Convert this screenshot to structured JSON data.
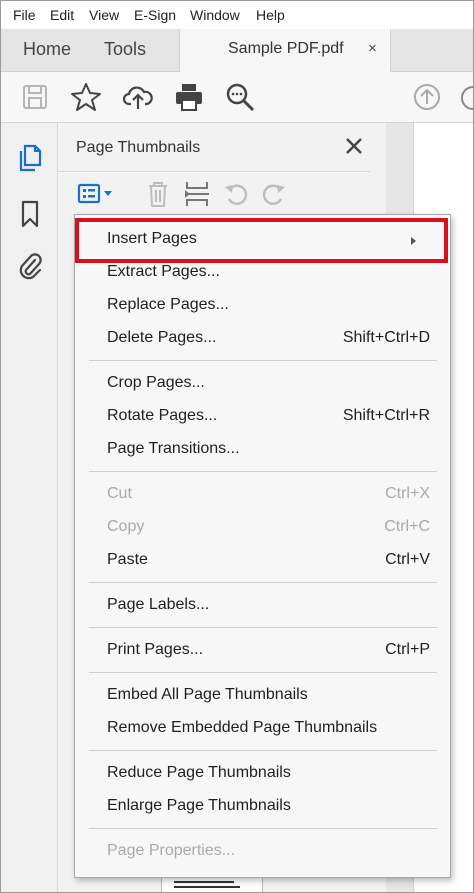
{
  "menubar": {
    "items": [
      "File",
      "Edit",
      "View",
      "E-Sign",
      "Window",
      "Help"
    ]
  },
  "tabs": {
    "home": "Home",
    "tools": "Tools",
    "document": "Sample PDF.pdf",
    "close": "×"
  },
  "toolbar": {
    "icons": [
      "save-icon",
      "star-icon",
      "cloud-upload-icon",
      "print-icon",
      "search-icon",
      "arrow-up-icon"
    ]
  },
  "rail": {
    "icons": [
      "pages-icon",
      "bookmark-icon",
      "attachment-icon"
    ]
  },
  "panel": {
    "title": "Page Thumbnails",
    "close": "✕",
    "tools": [
      "options-menu-icon",
      "delete-icon",
      "insert-pages-icon",
      "undo-icon",
      "redo-icon"
    ]
  },
  "menu": {
    "items": [
      {
        "label": "Insert Pages",
        "shortcut": "",
        "submenu": true,
        "enabled": true
      },
      {
        "label": "Extract Pages...",
        "shortcut": "",
        "enabled": true
      },
      {
        "label": "Replace Pages...",
        "shortcut": "",
        "enabled": true
      },
      {
        "label": "Delete Pages...",
        "shortcut": "Shift+Ctrl+D",
        "enabled": true
      },
      {
        "label": "Crop Pages...",
        "shortcut": "",
        "enabled": true
      },
      {
        "label": "Rotate Pages...",
        "shortcut": "Shift+Ctrl+R",
        "enabled": true
      },
      {
        "label": "Page Transitions...",
        "shortcut": "",
        "enabled": true
      },
      {
        "label": "Cut",
        "shortcut": "Ctrl+X",
        "enabled": false
      },
      {
        "label": "Copy",
        "shortcut": "Ctrl+C",
        "enabled": false
      },
      {
        "label": "Paste",
        "shortcut": "Ctrl+V",
        "enabled": true
      },
      {
        "label": "Page Labels...",
        "shortcut": "",
        "enabled": true
      },
      {
        "label": "Print Pages...",
        "shortcut": "Ctrl+P",
        "enabled": true
      },
      {
        "label": "Embed All Page Thumbnails",
        "shortcut": "",
        "enabled": true
      },
      {
        "label": "Remove Embedded Page Thumbnails",
        "shortcut": "",
        "enabled": true
      },
      {
        "label": "Reduce Page Thumbnails",
        "shortcut": "",
        "enabled": true
      },
      {
        "label": "Enlarge Page Thumbnails",
        "shortcut": "",
        "enabled": true
      },
      {
        "label": "Page Properties...",
        "shortcut": "",
        "enabled": false
      }
    ]
  },
  "colors": {
    "highlight": "#d9101c",
    "accent": "#1a6fc9"
  }
}
